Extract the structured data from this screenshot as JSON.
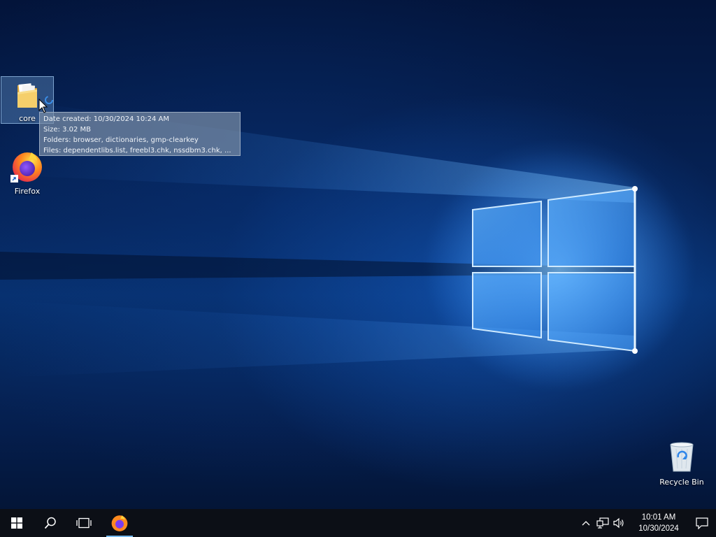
{
  "desktop": {
    "icons": [
      {
        "label": "core",
        "icon": "folder-icon",
        "selected": true
      },
      {
        "label": "Firefox",
        "icon": "firefox-icon",
        "shortcut": true
      },
      {
        "label": "Recycle Bin",
        "icon": "recycle-bin-icon"
      }
    ],
    "tooltip": {
      "lines": [
        "Date created: 10/30/2024 10:24 AM",
        "Size: 3.02 MB",
        "Folders: browser, dictionaries, gmp-clearkey",
        "Files: dependentlibs.list, freebl3.chk, nssdbm3.chk, ..."
      ]
    }
  },
  "taskbar": {
    "buttons": [
      {
        "icon": "windows-start-icon"
      },
      {
        "icon": "search-icon"
      },
      {
        "icon": "task-view-icon"
      },
      {
        "icon": "firefox-icon",
        "running": true
      }
    ],
    "tray": {
      "icons": [
        "chevron-up-icon",
        "network-icon",
        "volume-icon"
      ],
      "time": "10:01 AM",
      "date": "10/30/2024",
      "notification_icon": "notification-icon"
    }
  },
  "colors": {
    "accent": "#76b9ed",
    "taskbar": "#0c0f16",
    "wallpaper_dark": "#03143a",
    "wallpaper_glow": "#3c96ff"
  }
}
